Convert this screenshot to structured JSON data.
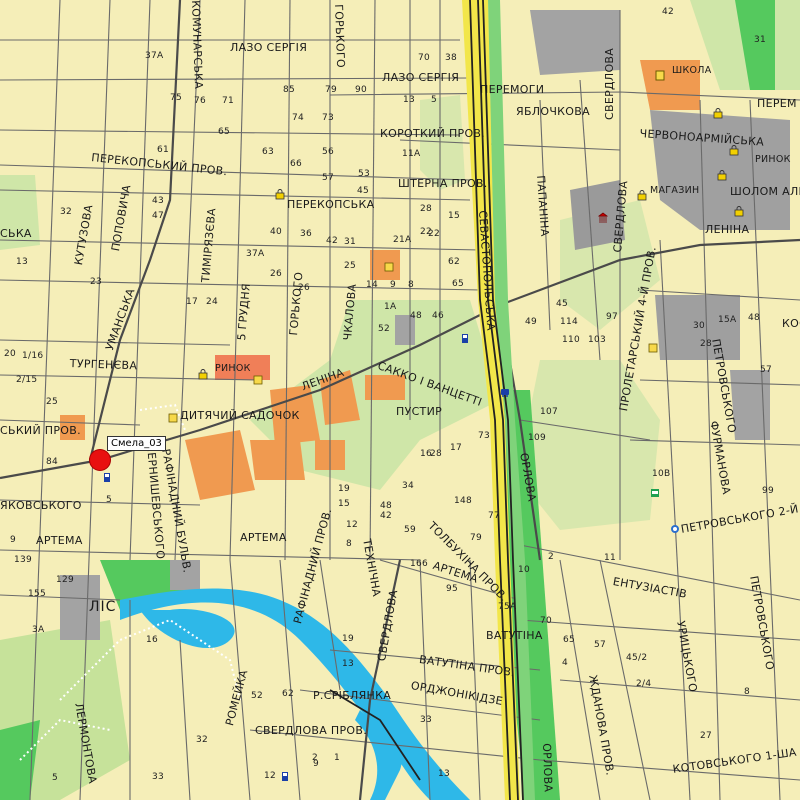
{
  "colors": {
    "background": "#f5eeb8",
    "road": "#5a5a5a",
    "railway": "#222222",
    "highway": "#f2e64a",
    "water": "#2eb8e8",
    "forest": "#55c95e",
    "park": "#cfe6a8",
    "industrial": "#f09a50",
    "civic": "#9a9a9a",
    "marker": "#e81010"
  },
  "marker": {
    "label": "Смела_03"
  },
  "streets": [
    {
      "text": "ЛАЗО СЕРГІЯ"
    },
    {
      "text": "ЛАЗО СЕРГІЯ"
    },
    {
      "text": "ПЕРЕМОГИ"
    },
    {
      "text": "ЯБЛОЧКОВА"
    },
    {
      "text": "КОРОТКИЙ ПРОВ."
    },
    {
      "text": "ПЕРЕКОПСЬКИЙ ПРОВ."
    },
    {
      "text": "ШТЕРНА ПРОВ."
    },
    {
      "text": "ПЕРЕКОПСЬКА"
    },
    {
      "text": "ТУРГЕНЄВА"
    },
    {
      "text": "ЛЕНІНА"
    },
    {
      "text": "САККО І ВАНЦЕТТІ"
    },
    {
      "text": "ПУСТИР"
    },
    {
      "text": "ДИТЯЧИЙ САДОЧОК"
    },
    {
      "text": "ЯКОВСЬКОГО"
    },
    {
      "text": "АРТЕМА"
    },
    {
      "text": "АРТЕМА"
    },
    {
      "text": "АРТЕМА"
    },
    {
      "text": "ЕНТУЗІАСТІВ"
    },
    {
      "text": "ВАТУТІНА"
    },
    {
      "text": "ВАТУТІНА ПРОВ."
    },
    {
      "text": "ОРДЖОНІКІДЗЕ"
    },
    {
      "text": "Р.СРІБЛЯНКА"
    },
    {
      "text": "СВЕРДЛОВА ПРОВ."
    },
    {
      "text": "ПЕТРОВСЬКОГО 2-Й"
    },
    {
      "text": "КОТОВСЬКОГО 1-ША"
    },
    {
      "text": "ЧЕРВОНОАРМІЙСЬКА"
    },
    {
      "text": "ШОЛОМ АЛЕЙХЕМА"
    },
    {
      "text": "ЛЕНІНА"
    },
    {
      "text": "ШКОЛА"
    },
    {
      "text": "МАГАЗИН"
    },
    {
      "text": "РИНОК"
    },
    {
      "text": "РИНОК"
    },
    {
      "text": "ЛІС"
    },
    {
      "text": "СЬКИЙ ПРОВ."
    },
    {
      "text": "СЬКА"
    },
    {
      "text": "ПЕРЕМ"
    },
    {
      "text": "КУТУЗОВА"
    },
    {
      "text": "ПОПОВИЧА"
    },
    {
      "text": "УМАНСЬКА"
    },
    {
      "text": "ТИМІРЯЗЄВА"
    },
    {
      "text": "5 ГРУДНЯ"
    },
    {
      "text": "ГОРЬКОГО"
    },
    {
      "text": "ЧКАЛОВА"
    },
    {
      "text": "СЕВАСТОПОЛЬСЬКА"
    },
    {
      "text": "ПАПАНІНА"
    },
    {
      "text": "СВЕРДЛОВА"
    },
    {
      "text": "СВЕРДЛОВА"
    },
    {
      "text": "СВЕРДЛОВА"
    },
    {
      "text": "ОРЛОВА"
    },
    {
      "text": "ОРЛОВА"
    },
    {
      "text": "ТОЛБУХІНА ПРОВ."
    },
    {
      "text": "ФУРМАНОВА"
    },
    {
      "text": "ПЕТРОВСЬКОГО"
    },
    {
      "text": "ПЕТРОВСЬКОГО"
    },
    {
      "text": "ПРОЛЕТАРСЬКИЙ 4-Й ПРОВ."
    },
    {
      "text": "РАФІНАДНИЙ БУЛЬВ."
    },
    {
      "text": "РАФІНАДНИЙ ПРОВ."
    },
    {
      "text": "ЧЕРНИШЕВСЬКОГО"
    },
    {
      "text": "ТЕХНІЧНА"
    },
    {
      "text": "РОМЕЙКА"
    },
    {
      "text": "ЛЕРМОНТОВА"
    },
    {
      "text": "УРИЦЬКОГО"
    },
    {
      "text": "ЖДАНОВА ПРОВ."
    },
    {
      "text": "КОМУНАРСЬКА"
    },
    {
      "text": "КОСЕ"
    },
    {
      "text": "ГОРЬКОГО"
    }
  ],
  "house_numbers": [
    "42",
    "31",
    "37А",
    "75",
    "76",
    "71",
    "85",
    "79",
    "90",
    "70",
    "38",
    "13",
    "5",
    "22",
    "63",
    "65",
    "74",
    "73",
    "66",
    "61",
    "56",
    "57",
    "11А",
    "53",
    "45",
    "43",
    "40",
    "36",
    "47",
    "42",
    "37А",
    "26",
    "31",
    "21А",
    "22",
    "25",
    "28",
    "15",
    "62",
    "24",
    "17",
    "26",
    "14",
    "9",
    "8",
    "65",
    "1А",
    "52",
    "48",
    "46",
    "45",
    "49",
    "114",
    "97",
    "30",
    "15А",
    "48",
    "110",
    "103",
    "28",
    "57",
    "107",
    "109",
    "10В",
    "99",
    "34",
    "28",
    "16",
    "17",
    "73",
    "48",
    "42",
    "59",
    "148",
    "77",
    "79",
    "19",
    "15",
    "12",
    "8",
    "5",
    "166",
    "95",
    "10",
    "2",
    "11",
    "75А",
    "70",
    "65",
    "57",
    "45/2",
    "4",
    "2/4",
    "8",
    "19",
    "27",
    "32",
    "16",
    "13",
    "33",
    "13",
    "2",
    "1",
    "12",
    "9",
    "52",
    "62",
    "5",
    "33",
    "84",
    "23",
    "32",
    "13",
    "20",
    "25",
    "155",
    "129",
    "139",
    "9",
    "3А",
    "1/16",
    "2/15"
  ]
}
